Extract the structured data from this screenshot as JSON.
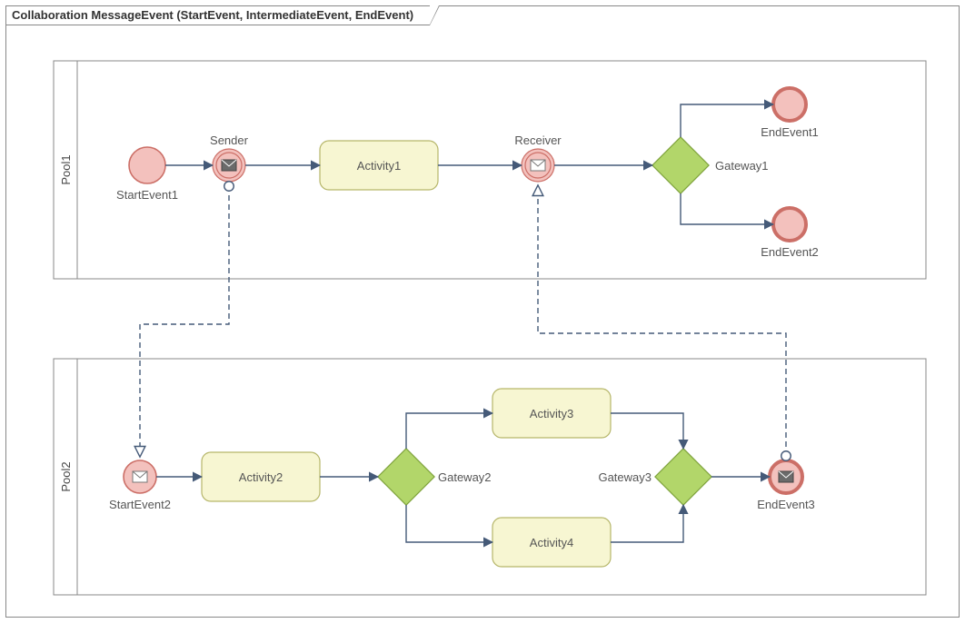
{
  "diagram": {
    "title": "Collaboration MessageEvent (StartEvent, IntermediateEvent, EndEvent)",
    "pools": [
      {
        "name": "Pool1"
      },
      {
        "name": "Pool2"
      }
    ],
    "nodes": {
      "startEvent1": {
        "label": "StartEvent1",
        "type": "startEvent",
        "pool": "Pool1"
      },
      "sender": {
        "label": "Sender",
        "type": "intermediateThrowMessage",
        "pool": "Pool1"
      },
      "activity1": {
        "label": "Activity1",
        "type": "task",
        "pool": "Pool1"
      },
      "receiver": {
        "label": "Receiver",
        "type": "intermediateCatchMessage",
        "pool": "Pool1"
      },
      "gateway1": {
        "label": "Gateway1",
        "type": "exclusiveGateway",
        "pool": "Pool1"
      },
      "endEvent1": {
        "label": "EndEvent1",
        "type": "endEvent",
        "pool": "Pool1"
      },
      "endEvent2": {
        "label": "EndEvent2",
        "type": "endEvent",
        "pool": "Pool1"
      },
      "startEvent2": {
        "label": "StartEvent2",
        "type": "startMessageEvent",
        "pool": "Pool2"
      },
      "activity2": {
        "label": "Activity2",
        "type": "task",
        "pool": "Pool2"
      },
      "gateway2": {
        "label": "Gateway2",
        "type": "exclusiveGateway",
        "pool": "Pool2"
      },
      "activity3": {
        "label": "Activity3",
        "type": "task",
        "pool": "Pool2"
      },
      "activity4": {
        "label": "Activity4",
        "type": "task",
        "pool": "Pool2"
      },
      "gateway3": {
        "label": "Gateway3",
        "type": "exclusiveGateway",
        "pool": "Pool2"
      },
      "endEvent3": {
        "label": "EndEvent3",
        "type": "endMessageEvent",
        "pool": "Pool2"
      }
    },
    "sequenceFlows": [
      [
        "startEvent1",
        "sender"
      ],
      [
        "sender",
        "activity1"
      ],
      [
        "activity1",
        "receiver"
      ],
      [
        "receiver",
        "gateway1"
      ],
      [
        "gateway1",
        "endEvent1"
      ],
      [
        "gateway1",
        "endEvent2"
      ],
      [
        "startEvent2",
        "activity2"
      ],
      [
        "activity2",
        "gateway2"
      ],
      [
        "gateway2",
        "activity3"
      ],
      [
        "gateway2",
        "activity4"
      ],
      [
        "activity3",
        "gateway3"
      ],
      [
        "activity4",
        "gateway3"
      ],
      [
        "gateway3",
        "endEvent3"
      ]
    ],
    "messageFlows": [
      [
        "sender",
        "startEvent2"
      ],
      [
        "endEvent3",
        "receiver"
      ]
    ]
  }
}
